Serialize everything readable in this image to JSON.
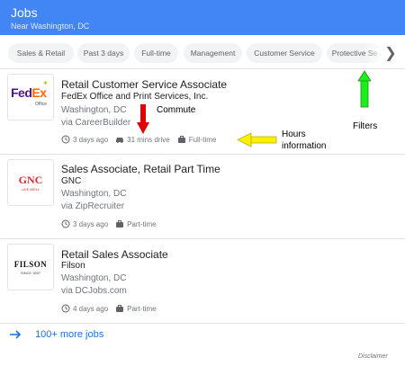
{
  "header": {
    "title": "Jobs",
    "subtitle": "Near Washington, DC"
  },
  "filters": [
    "Sales & Retail",
    "Past 3 days",
    "Full-time",
    "Management",
    "Customer Service",
    "Protective Se"
  ],
  "jobs": [
    {
      "title": "Retail Customer Service Associate",
      "company": "FedEx Office and Print Services, Inc.",
      "location": "Washington, DC",
      "via": "via CareerBuilder",
      "posted": "3 days ago",
      "commute": "31 mins drive",
      "type": "Full-time",
      "logo": {
        "part1": "Fed",
        "part2": "Ex",
        "sub": "Office"
      }
    },
    {
      "title": "Sales Associate, Retail Part Time",
      "company": "GNC",
      "location": "Washington, DC",
      "via": "via ZipRecruiter",
      "posted": "3 days ago",
      "type": "Part-time",
      "logo": {
        "text": "GNC",
        "sub": "LIVE WELL"
      }
    },
    {
      "title": "Retail Sales Associate",
      "company": "Filson",
      "location": "Washington, DC",
      "via": "via DCJobs.com",
      "posted": "4 days ago",
      "type": "Part-time",
      "logo": {
        "text": "FILSON",
        "sub": "SINCE 1897"
      }
    }
  ],
  "more_jobs": "100+ more jobs",
  "disclaimer": "Disclaimer",
  "annotations": {
    "commute": "Commute",
    "hours_line1": "Hours",
    "hours_line2": "information",
    "filters": "Filters"
  },
  "colors": {
    "header": "#4285f4",
    "link": "#1a73e8",
    "red_arrow": "#e00000",
    "green_arrow": "#1aef1a",
    "yellow_arrow": "#ffef00"
  },
  "icons": {
    "next": "chevron-right-icon",
    "posted": "clock-icon",
    "commute": "car-icon",
    "type": "briefcase-icon",
    "more": "arrow-right-icon"
  }
}
